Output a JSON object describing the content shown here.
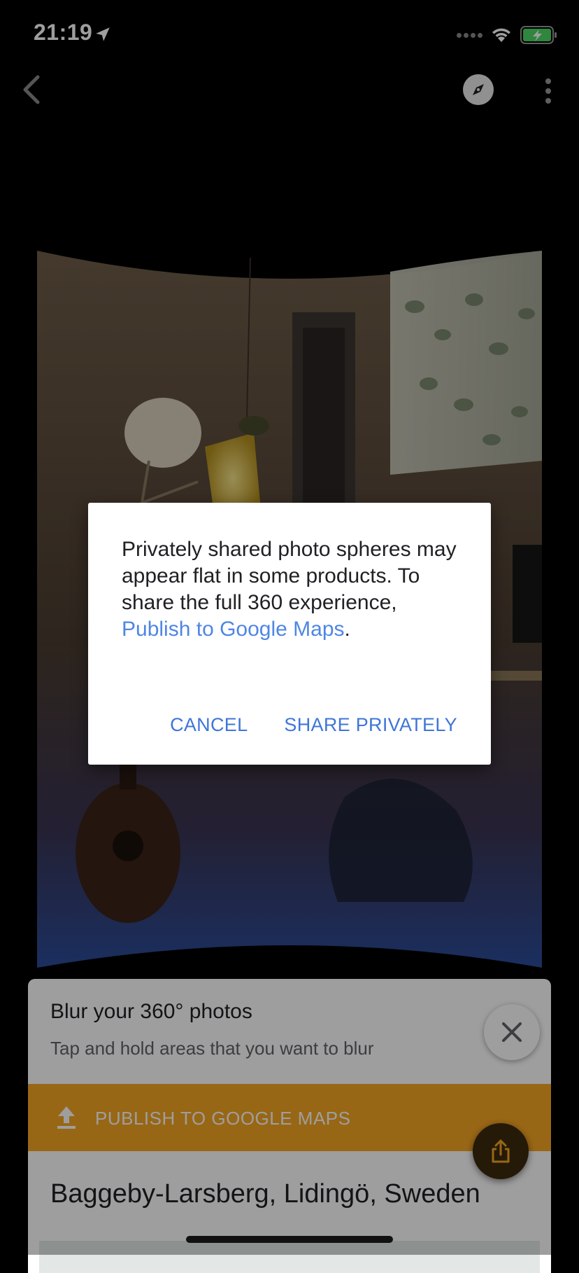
{
  "status_bar": {
    "time": "21:19"
  },
  "nav": {
    "back_icon": "chevron-left-icon",
    "compass_icon": "compass-icon",
    "more_icon": "more-vert-icon"
  },
  "sheet": {
    "title": "Blur your 360° photos",
    "subtitle": "Tap and hold areas that you want to blur",
    "publish_label": "PUBLISH TO GOOGLE MAPS",
    "place_name": "Baggeby-Larsberg, Lidingö, Sweden"
  },
  "dialog": {
    "message_part1": "Privately shared photo spheres may appear flat in some products. To share the full 360 experience, ",
    "link_text": "Publish to Google Maps",
    "message_part2": ".",
    "cancel_label": "CANCEL",
    "share_label": "SHARE PRIVATELY"
  },
  "colors": {
    "accent_blue": "#4f86e3",
    "publish_orange": "#f6a623",
    "battery_green": "#4cd964"
  }
}
